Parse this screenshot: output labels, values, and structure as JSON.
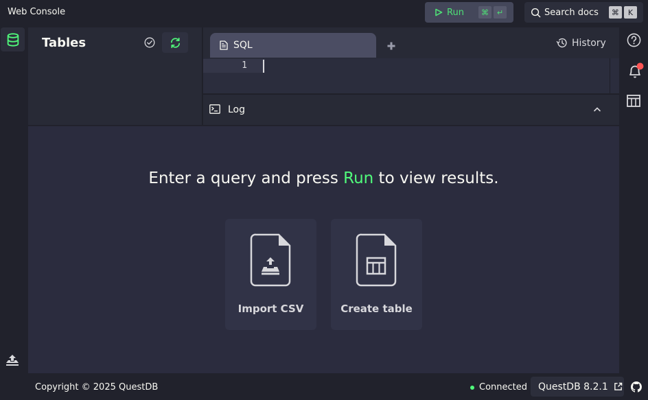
{
  "app": {
    "title": "Web Console"
  },
  "toolbar": {
    "run_label": "Run",
    "run_shortcut": [
      "⌘",
      "↵"
    ],
    "search_label": "Search docs",
    "search_shortcut": [
      "⌘",
      "K"
    ]
  },
  "tables_panel": {
    "title": "Tables"
  },
  "editor": {
    "tabs": [
      {
        "label": "SQL",
        "icon": "file-text-icon"
      }
    ],
    "history_label": "History",
    "line_numbers": [
      "1"
    ],
    "content": ""
  },
  "log": {
    "label": "Log"
  },
  "results": {
    "message_before": "Enter a query and press ",
    "message_accent": "Run",
    "message_after": " to view results.",
    "cards": [
      {
        "label": "Import CSV",
        "icon": "file-upload-icon"
      },
      {
        "label": "Create table",
        "icon": "file-table-icon"
      }
    ]
  },
  "footer": {
    "copyright": "Copyright © 2025 QuestDB",
    "status": "Connected",
    "version": "QuestDB 8.2.1"
  },
  "colors": {
    "accent": "#50fa7b",
    "background": "#21222c",
    "panel": "#282a36",
    "notification": "#ff5555"
  }
}
